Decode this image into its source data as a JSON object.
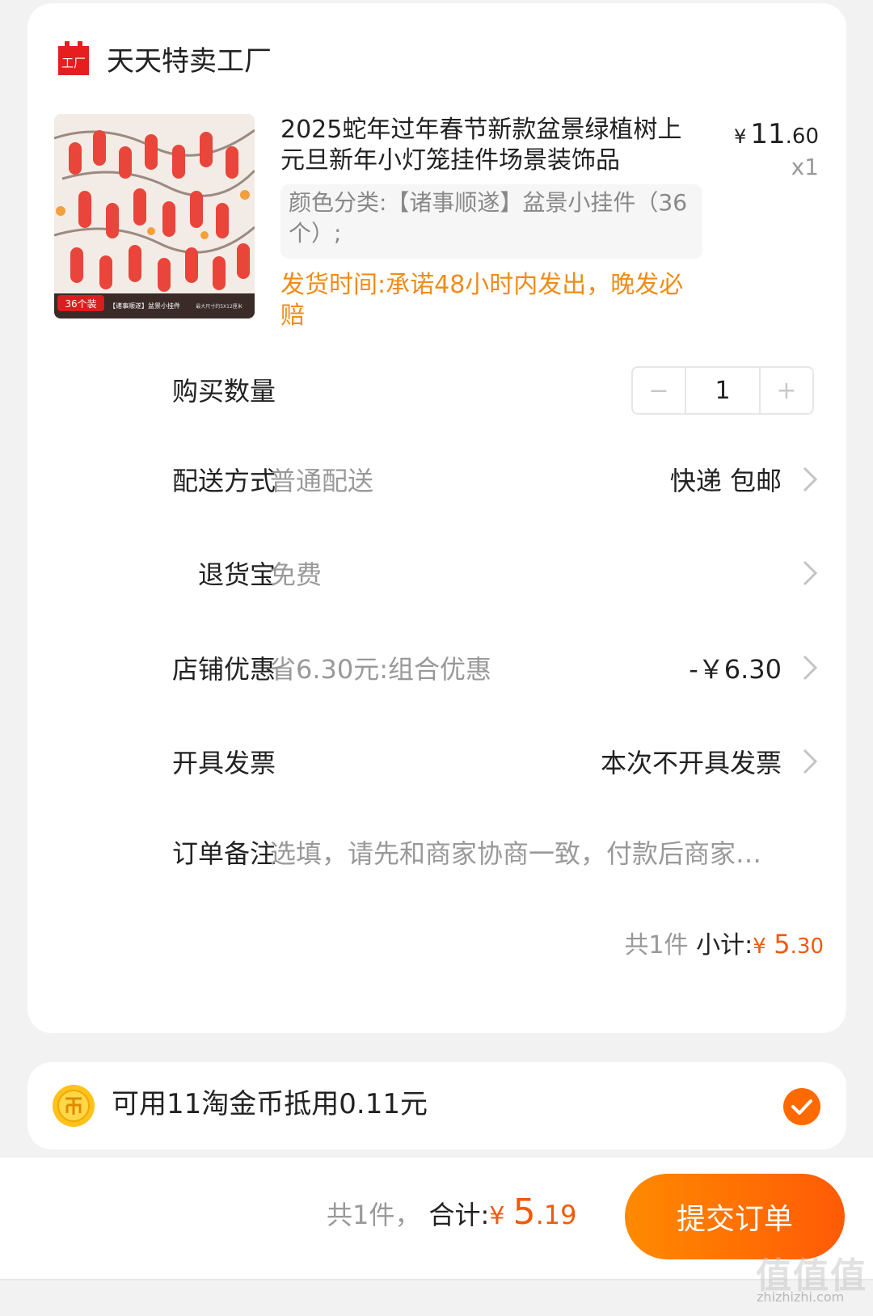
{
  "shop": {
    "name": "天天特卖工厂",
    "logo_text": "工厂"
  },
  "product": {
    "title": "2025蛇年过年春节新款盆景绿植树上元旦新年小灯笼挂件场景装饰品",
    "price_symbol": "¥",
    "price_int": "11",
    "price_dec": ".60",
    "quantity": "x1",
    "sku": "颜色分类:【诸事顺遂】盆景小挂件（36个）;",
    "ship_note": "发货时间:承诺48小时内发出，晚发必赔",
    "image_badge": "36个装",
    "image_caption": "【诸事顺遂】盆景小挂件",
    "image_size": "最大尺寸约5X12厘米"
  },
  "rows": {
    "quantity": {
      "label": "购买数量",
      "value": "1",
      "minus": "−",
      "plus": "+"
    },
    "delivery": {
      "label": "配送方式",
      "sub": "普通配送",
      "right": "快递 包邮"
    },
    "return": {
      "label": "退货宝",
      "sub": "免费"
    },
    "discount": {
      "label": "店铺优惠",
      "sub": "省6.30元:组合优惠",
      "right": "-￥6.30"
    },
    "invoice": {
      "label": "开具发票",
      "right": "本次不开具发票"
    },
    "remark": {
      "label": "订单备注",
      "placeholder": "选填，请先和商家协商一致，付款后商家…"
    }
  },
  "subtotal": {
    "count": "共1件",
    "label": "小计:",
    "symbol": "¥",
    "int": "5",
    "dec": ".30"
  },
  "coins": {
    "text": "可用11淘金币抵用0.11元",
    "checked": true
  },
  "footer": {
    "count": "共1件，",
    "label": "合计:",
    "symbol": "¥",
    "int": "5",
    "dec": ".19",
    "submit": "提交订单"
  },
  "watermark": {
    "main": "值值值",
    "sub": "zhizhizhi.com"
  },
  "colors": {
    "accent": "#ff6a00",
    "price": "#f05a0a",
    "ship_note": "#f08c17"
  }
}
